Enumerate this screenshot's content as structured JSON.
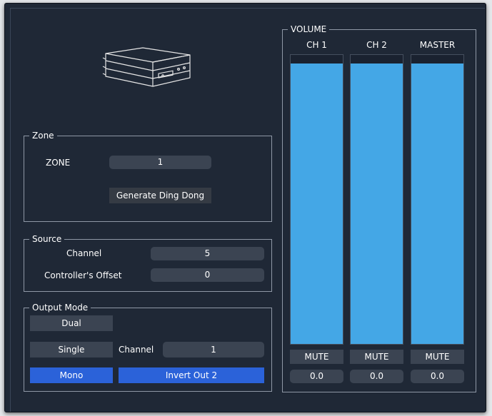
{
  "zone": {
    "title": "Zone",
    "zone_label": "ZONE",
    "zone_value": "1",
    "ding_button": "Generate Ding Dong"
  },
  "source": {
    "title": "Source",
    "channel_label": "Channel",
    "channel_value": "5",
    "offset_label": "Controller's Offset",
    "offset_value": "0"
  },
  "output_mode": {
    "title": "Output Mode",
    "dual": "Dual",
    "single": "Single",
    "channel_label": "Channel",
    "channel_value": "1",
    "mono": "Mono",
    "invert_out2": "Invert Out 2",
    "selected": "Mono"
  },
  "volume": {
    "title": "VOLUME",
    "channels": [
      {
        "label": "CH 1",
        "level": 0.97,
        "mute": "MUTE",
        "value": "0.0"
      },
      {
        "label": "CH 2",
        "level": 0.97,
        "mute": "MUTE",
        "value": "0.0"
      },
      {
        "label": "MASTER",
        "level": 0.97,
        "mute": "MUTE",
        "value": "0.0"
      }
    ]
  },
  "colors": {
    "panel_bg": "#1f2836",
    "field_bg": "#3b4452",
    "active_button": "#2b62d9",
    "meter_fill": "#44a7e6",
    "group_border": "#8f98a6"
  },
  "icons": {
    "device": "audio-device-icon"
  }
}
